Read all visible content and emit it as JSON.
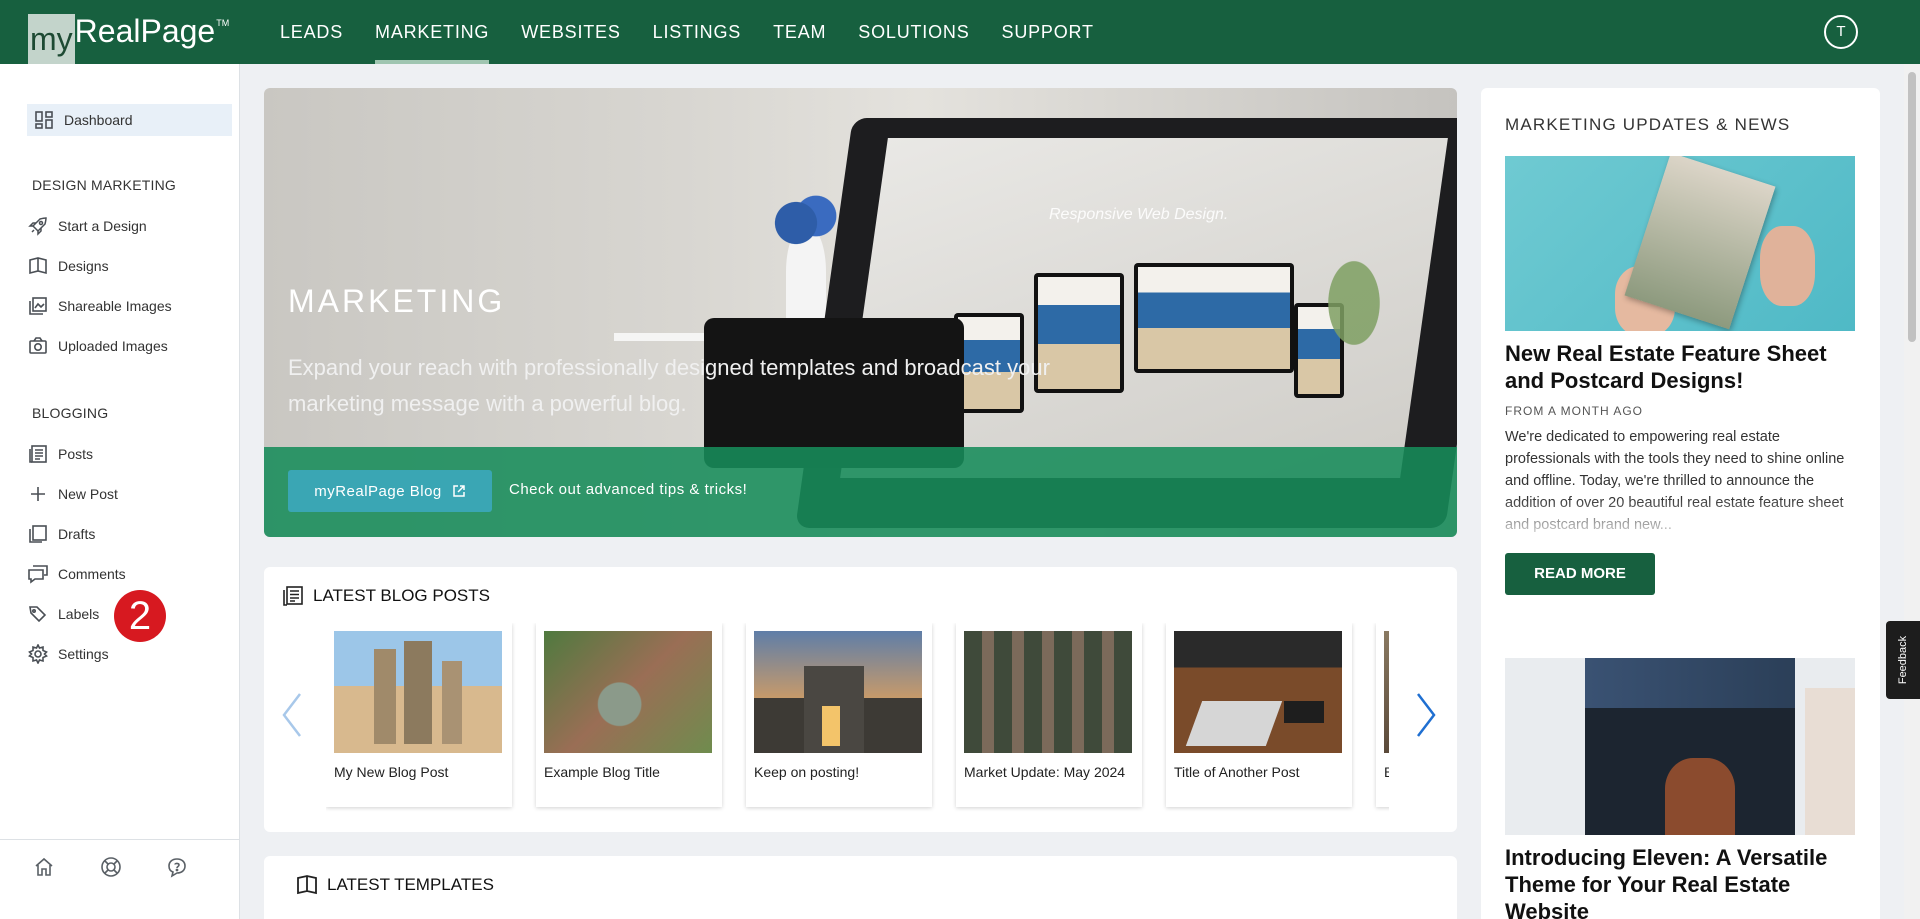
{
  "brand": {
    "logo_box": "my",
    "logo_text": "RealPage",
    "logo_tm": "TM"
  },
  "topnav": {
    "items": [
      {
        "label": "LEADS"
      },
      {
        "label": "MARKETING"
      },
      {
        "label": "WEBSITES"
      },
      {
        "label": "LISTINGS"
      },
      {
        "label": "TEAM"
      },
      {
        "label": "SOLUTIONS"
      },
      {
        "label": "SUPPORT"
      }
    ],
    "active_index": 1,
    "avatar_initial": "T"
  },
  "sidebar": {
    "dashboard": "Dashboard",
    "design_heading": "DESIGN MARKETING",
    "design_items": [
      {
        "label": "Start a Design",
        "icon": "rocket-icon"
      },
      {
        "label": "Designs",
        "icon": "book-open-icon"
      },
      {
        "label": "Shareable Images",
        "icon": "images-icon"
      },
      {
        "label": "Uploaded Images",
        "icon": "camera-icon"
      }
    ],
    "blog_heading": "BLOGGING",
    "blog_items": [
      {
        "label": "Posts",
        "icon": "list-doc-icon"
      },
      {
        "label": "New Post",
        "icon": "plus-icon"
      },
      {
        "label": "Drafts",
        "icon": "copy-icon"
      },
      {
        "label": "Comments",
        "icon": "comments-icon"
      },
      {
        "label": "Labels",
        "icon": "tag-icon"
      },
      {
        "label": "Settings",
        "icon": "gear-icon"
      }
    ],
    "annotation_badge": "2",
    "footer_icons": [
      "home-icon",
      "lifebuoy-icon",
      "help-chat-icon"
    ]
  },
  "hero": {
    "title": "MARKETING",
    "subtitle": "Expand your reach with professionally designed templates and broadcast your marketing message with a powerful blog.",
    "button_label": "myRealPage Blog",
    "band_text": "Check out advanced tips & tricks!",
    "screen_text": "Responsive Web Design.",
    "colors": {
      "band": "#178c5a",
      "button": "#3aa6b4"
    }
  },
  "blog_posts": {
    "title": "LATEST BLOG POSTS",
    "cards": [
      {
        "caption": "My New Blog Post"
      },
      {
        "caption": "Example Blog Title"
      },
      {
        "caption": "Keep on posting!"
      },
      {
        "caption": "Market Update: May 2024"
      },
      {
        "caption": "Title of Another Post"
      },
      {
        "caption": "Bl"
      }
    ]
  },
  "templates": {
    "title": "LATEST TEMPLATES"
  },
  "news": {
    "heading": "MARKETING UPDATES & NEWS",
    "article1": {
      "title": "New Real Estate Feature Sheet and Postcard Designs!",
      "meta": "FROM A MONTH AGO",
      "body": "We're dedicated to empowering real estate professionals with the tools they need to shine online and offline. Today, we're thrilled to announce the addition of over 20 beautiful real estate feature sheet and postcard brand new...",
      "button": "READ MORE"
    },
    "article2": {
      "title": "Introducing Eleven: A Versatile Theme for Your Real Estate Website"
    },
    "watermark": "myRealPage"
  },
  "feedback_label": "Feedback",
  "colors": {
    "primary": "#17603f",
    "accent_arrow": "#1f6fd1",
    "badge": "#d71920"
  }
}
